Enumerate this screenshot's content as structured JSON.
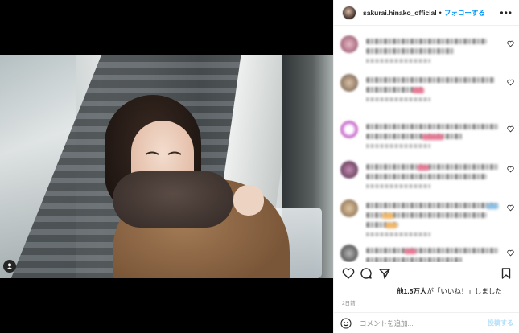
{
  "post": {
    "username": "sakurai.hinako_official",
    "separator": "•",
    "follow_label": "フォローする",
    "more_label": "•••"
  },
  "icons": {
    "tag": "user-tag-icon",
    "heart": "heart-icon",
    "comment": "comment-icon",
    "share": "paper-plane-icon",
    "bookmark": "bookmark-icon",
    "emoji": "smiley-icon",
    "more": "more-horizontal-icon"
  },
  "colors": {
    "follow_blue": "#0095f6",
    "post_disabled": "#b2dffc",
    "muted_text": "#8e8e8e"
  },
  "engagement": {
    "likes_count": "他1.5万人",
    "likes_suffix": "が「いいね！」しました",
    "timestamp": "2日前"
  },
  "comment_box": {
    "placeholder": "コメントを追加...",
    "post_label": "投稿する"
  }
}
